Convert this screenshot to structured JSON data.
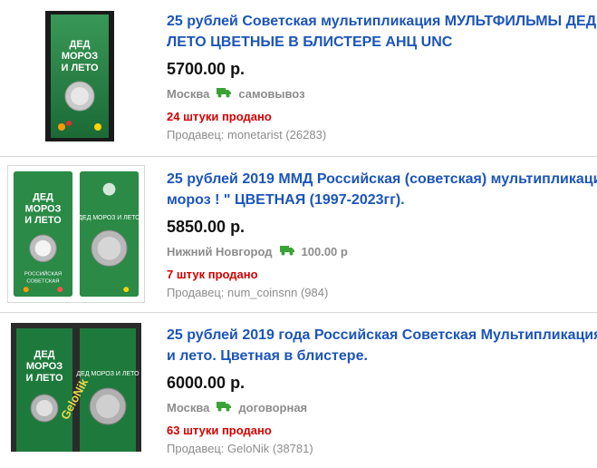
{
  "listings": [
    {
      "title_line1": "25 рублей Советская мультипликация МУЛЬТФИЛЬМЫ ДЕД",
      "title_line2": "ЛЕТО ЦВЕТНЫЕ В БЛИСТЕРЕ АНЦ UNC",
      "price": "5700.00 р.",
      "city": "Москва",
      "delivery": "самовывоз",
      "sold": "24 штуки продано",
      "seller_label": "Продавец:",
      "seller_name": "monetarist",
      "seller_rating": "(26283)",
      "thumb": {
        "card_title": "ДЕД МОРОЗ И ЛЕТО",
        "watermark": ""
      }
    },
    {
      "title_line1": "25 рублей 2019 ММД Российская (советская) мультипликаци",
      "title_line2": "мороз ! \" ЦВЕТНАЯ (1997-2023гг).",
      "price": "5850.00 р.",
      "city": "Нижний Новгород",
      "delivery": "100.00 р",
      "sold": "7 штук продано",
      "seller_label": "Продавец:",
      "seller_name": "num_coinsnn",
      "seller_rating": "(984)",
      "thumb": {
        "card_title": "ДЕД МОРОЗ И ЛЕТО",
        "watermark": ""
      }
    },
    {
      "title_line1": "25 рублей 2019 года Российская Советская Мультипликация",
      "title_line2": "и лето. Цветная в блистере.",
      "price": "6000.00 р.",
      "city": "Москва",
      "delivery": "договорная",
      "sold": "63 штуки продано",
      "seller_label": "Продавец:",
      "seller_name": "GeloNik",
      "seller_rating": "(38781)",
      "thumb": {
        "card_title": "ДЕД МОРОЗ И ЛЕТО",
        "watermark": "GeloNik"
      }
    }
  ],
  "colors": {
    "link": "#1c55b9",
    "sold": "#d40000",
    "muted": "#8c8c8c",
    "truck": "#3aa335",
    "card_green": "#1f7a3c"
  },
  "icons": {
    "delivery": "truck-icon"
  }
}
